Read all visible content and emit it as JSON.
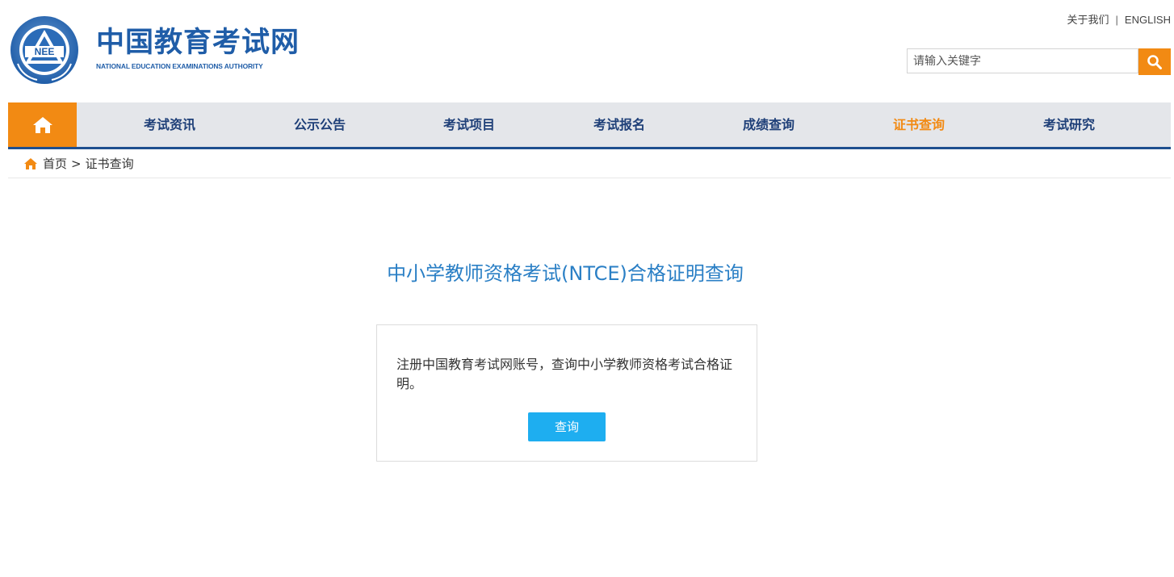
{
  "brand": {
    "emblem_text": "NEE",
    "name_cn": "中国教育考试网",
    "name_en": "NATIONAL EDUCATION EXAMINATIONS AUTHORITY",
    "color": "#1f5da8"
  },
  "top_links": {
    "about": "关于我们",
    "separator": "|",
    "english": "ENGLISH"
  },
  "search": {
    "placeholder": "请输入关键字",
    "value": "",
    "button_icon": "search-icon"
  },
  "nav": {
    "home_icon": "home-icon",
    "items": [
      {
        "label": "考试资讯"
      },
      {
        "label": "公示公告"
      },
      {
        "label": "考试项目"
      },
      {
        "label": "考试报名"
      },
      {
        "label": "成绩查询"
      },
      {
        "label": "证书查询",
        "active": true
      },
      {
        "label": "考试研究"
      }
    ]
  },
  "breadcrumb": {
    "home": "首页",
    "separator": ">",
    "current": "证书查询"
  },
  "main": {
    "title": "中小学教师资格考试(NTCE)合格证明查询",
    "description": "注册中国教育考试网账号，查询中小学教师资格考试合格证明。",
    "query_button": "查询"
  },
  "colors": {
    "accent": "#f28a13",
    "nav_text": "#1e3f78",
    "title": "#2a7fc5",
    "button": "#1eaef0"
  }
}
